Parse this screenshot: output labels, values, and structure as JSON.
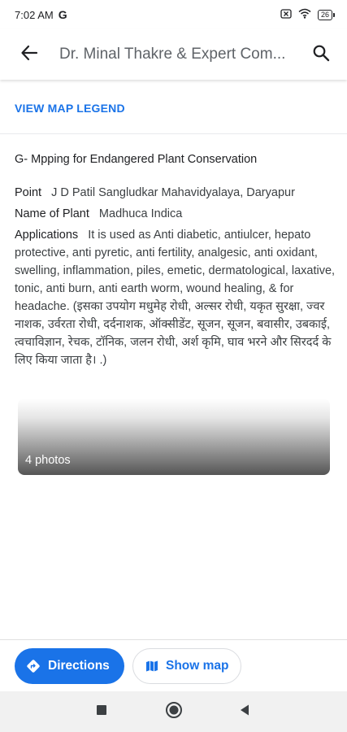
{
  "status_bar": {
    "time": "7:02 AM",
    "notification_icon": "G",
    "battery": "26",
    "icons": [
      "sim-off-icon",
      "wifi-icon",
      "battery-icon"
    ]
  },
  "app_bar": {
    "title": "Dr. Minal Thakre & Expert Com...",
    "back_icon": "back-arrow-icon",
    "search_icon": "search-icon"
  },
  "legend": {
    "label": "VIEW MAP LEGEND"
  },
  "place": {
    "title": "G- Mpping for Endangered Plant Conservation",
    "fields": [
      {
        "label": "Point",
        "value": "J D Patil Sangludkar Mahavidyalaya, Daryapur"
      },
      {
        "label": "Name of Plant",
        "value": "Madhuca Indica"
      },
      {
        "label": "Applications",
        "value": "It is used as Anti diabetic, antiulcer, hepato protective, anti pyretic, anti fertility, analgesic, anti oxidant, swelling, inflammation, piles, emetic, dermatological, laxative, tonic, anti burn, anti earth worm, wound healing, & for headache. (इसका उपयोग मधुमेह रोधी, अल्सर रोधी, यकृत सुरक्षा, ज्वर नाशक, उर्वरता रोधी, दर्दनाशक, ऑक्सीडेंट, सूजन, सूजन, बवासीर, उबकाई, त्वचाविज्ञान, रेचक, टॉनिक, जलन रोधी, अर्श कृमि, घाव भरने और सिरदर्द के लिए किया जाता है। .)"
      }
    ]
  },
  "photos": {
    "label": "4 photos"
  },
  "actions": {
    "directions_label": "Directions",
    "show_map_label": "Show map",
    "accent": "#1a73e8"
  },
  "nav": {
    "buttons": [
      "recents-square-icon",
      "home-circle-icon",
      "back-triangle-icon"
    ]
  }
}
